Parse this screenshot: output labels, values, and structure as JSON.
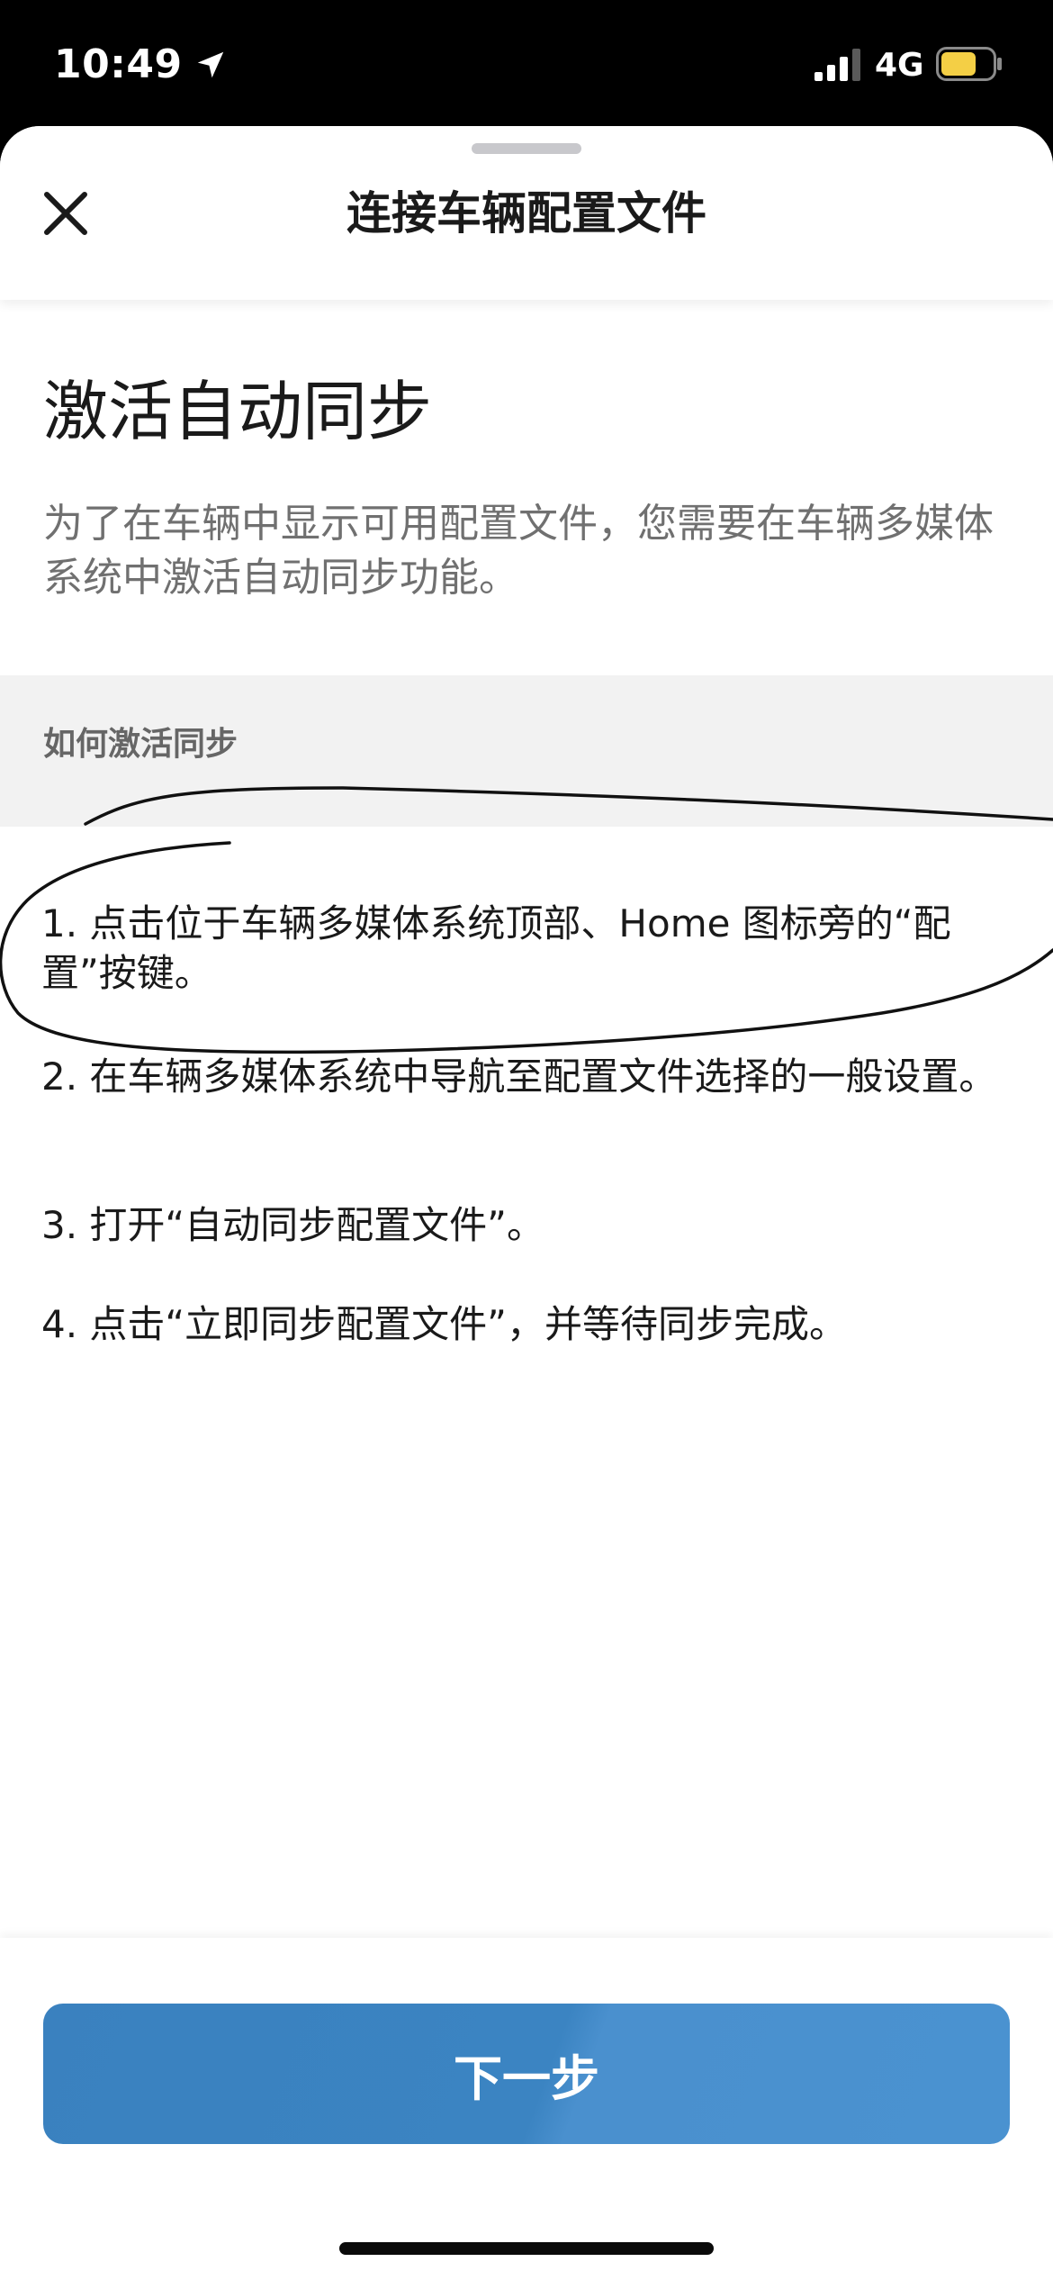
{
  "status_bar": {
    "time": "10:49",
    "network": "4G",
    "icons": [
      "location-arrow-icon",
      "signal-bars-icon",
      "battery-icon"
    ],
    "battery_color": "#f4cf45"
  },
  "header": {
    "title": "连接车辆配置文件",
    "close_icon": "close-icon"
  },
  "content": {
    "title": "激活自动同步",
    "description": "为了在车辆中显示可用配置文件，您需要在车辆多媒体系统中激活自动同步功能。",
    "section_header": "如何激活同步",
    "steps": [
      "1. 点击位于车辆多媒体系统顶部、Home 图标旁的“配置”按键。",
      "2. 在车辆多媒体系统中导航至配置文件选择的一般设置。",
      "3. 打开“自动同步配置文件”。",
      "4. 点击“立即同步配置文件”，并等待同步完成。"
    ]
  },
  "footer": {
    "next_button_label": "下一步",
    "button_color": "#3b84c2"
  }
}
